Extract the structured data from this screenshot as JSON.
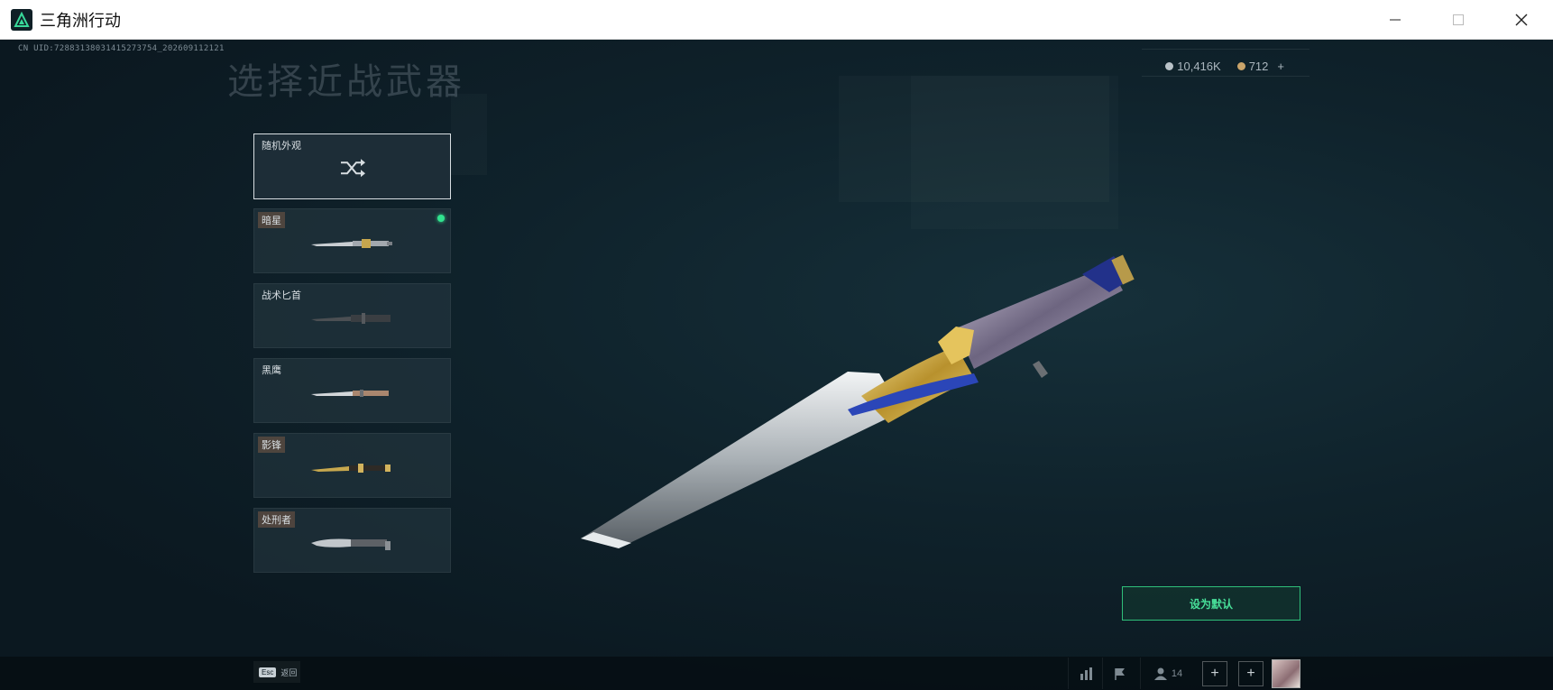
{
  "window": {
    "title": "三角洲行动"
  },
  "header": {
    "uid": "CN UID:72883138031415273754_202609112121",
    "page_title": "选择近战武器"
  },
  "currency": {
    "silver": "10,416K",
    "gold": "712",
    "add": "+"
  },
  "cards": [
    {
      "label": "随机外观",
      "icon": "shuffle-icon"
    },
    {
      "label": "暗星",
      "equipped": true
    },
    {
      "label": "战术匕首"
    },
    {
      "label": "黑鹰"
    },
    {
      "label": "影锋"
    },
    {
      "label": "处刑者"
    }
  ],
  "actions": {
    "set_default": "设为默认"
  },
  "bottom": {
    "esc_key": "Esc",
    "esc_label": "返回",
    "friends_count": "14",
    "plus": "+"
  },
  "colors": {
    "accent_green": "#31e38f",
    "background": "#0e1a22"
  }
}
